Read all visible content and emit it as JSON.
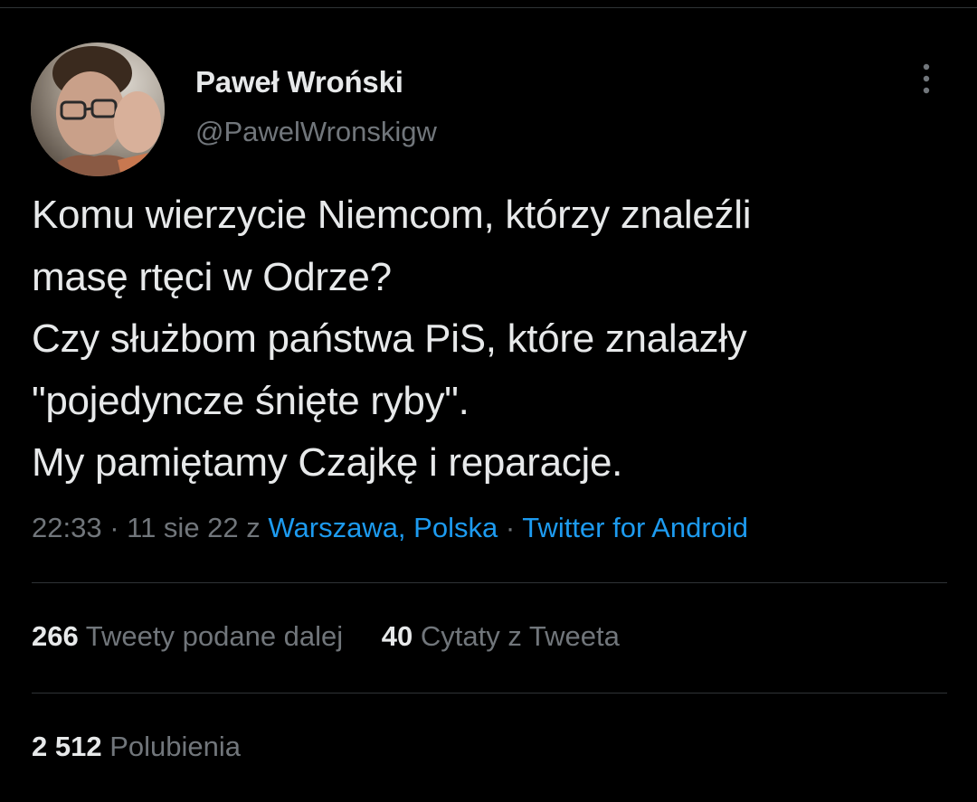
{
  "author": {
    "display_name": "Paweł Wroński",
    "handle": "@PawelWronskigw",
    "avatar_icon": "profile-photo"
  },
  "menu": {
    "icon": "more-vertical-icon"
  },
  "tweet": {
    "lines": [
      "Komu wierzycie Niemcom, którzy znaleźli",
      "masę rtęci w Odrze?",
      "Czy służbom państwa PiS, które znalazły",
      "\"pojedyncze śnięte ryby\".",
      "My pamiętamy Czajkę i reparacje."
    ]
  },
  "meta": {
    "time": "22:33",
    "separator": " · ",
    "date": "11 sie 22",
    "from": " z ",
    "location": "Warszawa, Polska",
    "source": "Twitter for Android"
  },
  "stats": {
    "retweets_count": "266",
    "retweets_label": "Tweety podane dalej",
    "quotes_count": "40",
    "quotes_label": "Cytaty z Tweeta",
    "likes_count": "2 512",
    "likes_label": "Polubienia"
  },
  "colors": {
    "background": "#000000",
    "text": "#e7e9ea",
    "secondary_text": "#71767b",
    "link": "#1d9bf0",
    "divider": "#2f3336"
  }
}
